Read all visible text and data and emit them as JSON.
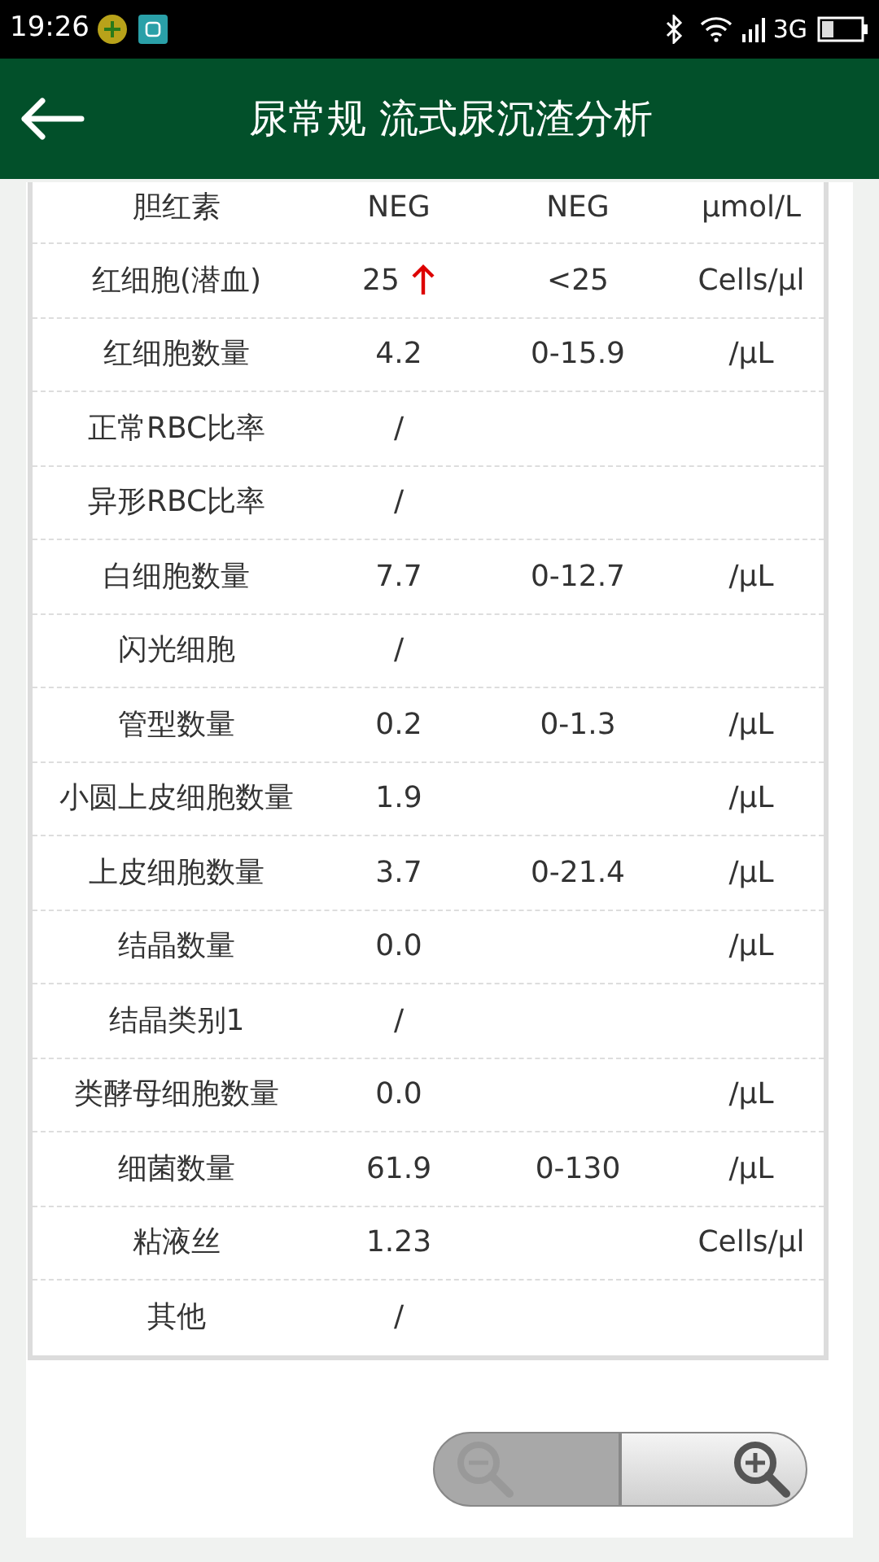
{
  "status_bar": {
    "time": "19:26",
    "network": "3G"
  },
  "header": {
    "title": "尿常规 流式尿沉渣分析"
  },
  "table": {
    "rows": [
      {
        "name": "胆红素",
        "value": "NEG",
        "high": false,
        "range": "NEG",
        "unit": "μmol/L"
      },
      {
        "name": "红细胞(潜血)",
        "value": "25",
        "high": true,
        "range": "<25",
        "unit": "Cells/μl"
      },
      {
        "name": "红细胞数量",
        "value": "4.2",
        "high": false,
        "range": "0-15.9",
        "unit": "/μL"
      },
      {
        "name": "正常RBC比率",
        "value": "/",
        "high": false
      },
      {
        "name": "异形RBC比率",
        "value": "/",
        "high": false
      },
      {
        "name": "白细胞数量",
        "value": "7.7",
        "high": false,
        "range": "0-12.7",
        "unit": "/μL"
      },
      {
        "name": "闪光细胞",
        "value": "/",
        "high": false
      },
      {
        "name": "管型数量",
        "value": "0.2",
        "high": false,
        "range": "0-1.3",
        "unit": "/μL"
      },
      {
        "name": "小圆上皮细胞数量",
        "value": "1.9",
        "high": false,
        "unit": "/μL"
      },
      {
        "name": "上皮细胞数量",
        "value": "3.7",
        "high": false,
        "range": "0-21.4",
        "unit": "/μL"
      },
      {
        "name": "结晶数量",
        "value": "0.0",
        "high": false,
        "unit": "/μL"
      },
      {
        "name": "结晶类别1",
        "value": "/",
        "high": false
      },
      {
        "name": "类酵母细胞数量",
        "value": "0.0",
        "high": false,
        "unit": "/μL"
      },
      {
        "name": "细菌数量",
        "value": "61.9",
        "high": false,
        "range": "0-130",
        "unit": "/μL"
      },
      {
        "name": "粘液丝",
        "value": "1.23",
        "high": false,
        "unit": "Cells/μl"
      },
      {
        "name": "其他",
        "value": "/",
        "high": false
      }
    ]
  },
  "zoom_control": {
    "zoom_out_disabled": true,
    "zoom_in_disabled": false
  }
}
